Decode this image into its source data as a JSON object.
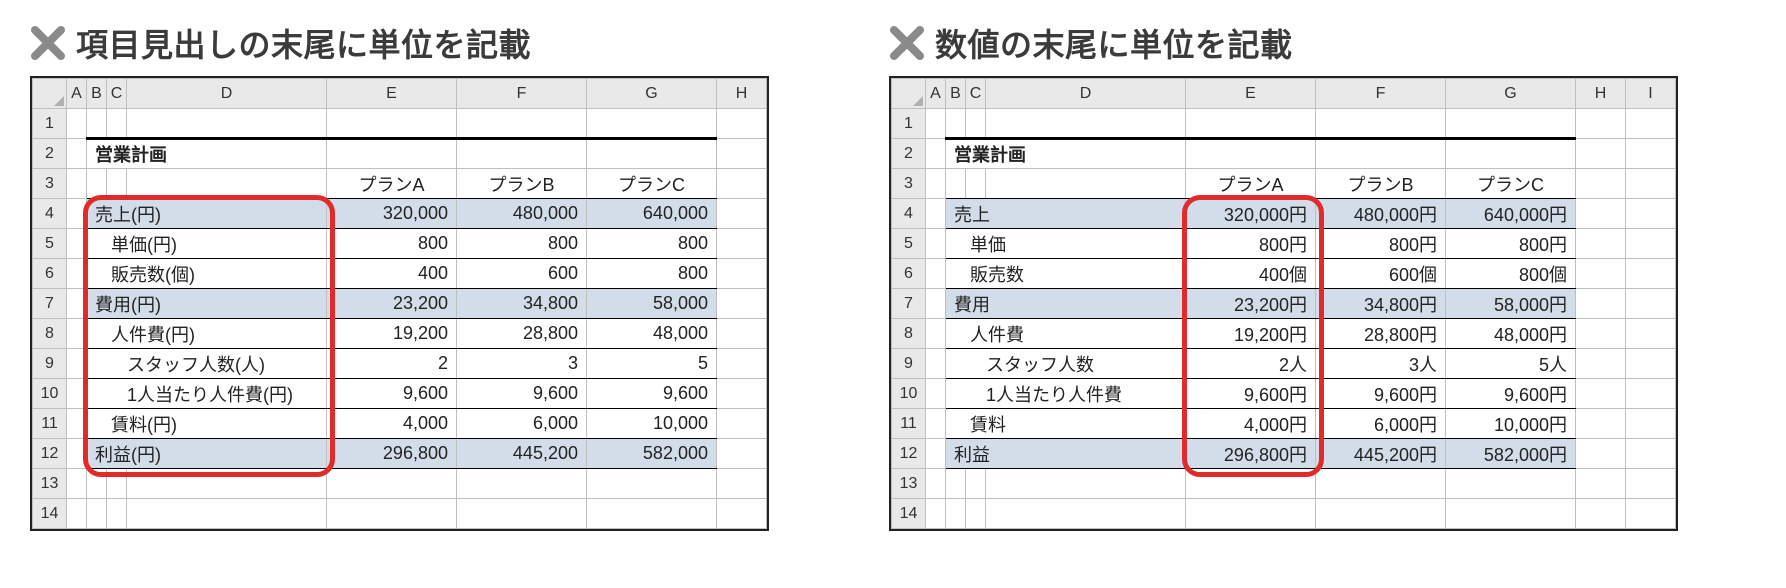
{
  "left": {
    "title": "項目見出しの末尾に単位を記載",
    "cols": [
      "A",
      "B",
      "C",
      "D",
      "E",
      "F",
      "G",
      "H"
    ],
    "tableTitle": "営業計画",
    "planHeaders": {
      "e": "プランA",
      "f": "プランB",
      "g": "プランC"
    },
    "rows": [
      {
        "label": "売上(円)",
        "e": "320,000",
        "f": "480,000",
        "g": "640,000",
        "shaded": true,
        "indent": 0,
        "uline": true
      },
      {
        "label": "単価(円)",
        "e": "800",
        "f": "800",
        "g": "800",
        "shaded": false,
        "indent": 1,
        "uline": true
      },
      {
        "label": "販売数(個)",
        "e": "400",
        "f": "600",
        "g": "800",
        "shaded": false,
        "indent": 1,
        "uline": true
      },
      {
        "label": "費用(円)",
        "e": "23,200",
        "f": "34,800",
        "g": "58,000",
        "shaded": true,
        "indent": 0,
        "uline": true
      },
      {
        "label": "人件費(円)",
        "e": "19,200",
        "f": "28,800",
        "g": "48,000",
        "shaded": false,
        "indent": 1,
        "uline": true
      },
      {
        "label": "スタッフ人数(人)",
        "e": "2",
        "f": "3",
        "g": "5",
        "shaded": false,
        "indent": 2,
        "uline": true
      },
      {
        "label": "1人当たり人件費(円)",
        "e": "9,600",
        "f": "9,600",
        "g": "9,600",
        "shaded": false,
        "indent": 2,
        "uline": true
      },
      {
        "label": "賃料(円)",
        "e": "4,000",
        "f": "6,000",
        "g": "10,000",
        "shaded": false,
        "indent": 1,
        "uline": true
      },
      {
        "label": "利益(円)",
        "e": "296,800",
        "f": "445,200",
        "g": "582,000",
        "shaded": true,
        "indent": 0,
        "uline": true
      }
    ],
    "highlightTarget": "labels"
  },
  "right": {
    "title": "数値の末尾に単位を記載",
    "cols": [
      "A",
      "B",
      "C",
      "D",
      "E",
      "F",
      "G",
      "H",
      "I"
    ],
    "tableTitle": "営業計画",
    "planHeaders": {
      "e": "プランA",
      "f": "プランB",
      "g": "プランC"
    },
    "rows": [
      {
        "label": "売上",
        "e": "320,000円",
        "f": "480,000円",
        "g": "640,000円",
        "shaded": true,
        "indent": 0,
        "uline": true
      },
      {
        "label": "単価",
        "e": "800円",
        "f": "800円",
        "g": "800円",
        "shaded": false,
        "indent": 1,
        "uline": true
      },
      {
        "label": "販売数",
        "e": "400個",
        "f": "600個",
        "g": "800個",
        "shaded": false,
        "indent": 1,
        "uline": true
      },
      {
        "label": "費用",
        "e": "23,200円",
        "f": "34,800円",
        "g": "58,000円",
        "shaded": true,
        "indent": 0,
        "uline": true
      },
      {
        "label": "人件費",
        "e": "19,200円",
        "f": "28,800円",
        "g": "48,000円",
        "shaded": false,
        "indent": 1,
        "uline": true
      },
      {
        "label": "スタッフ人数",
        "e": "2人",
        "f": "3人",
        "g": "5人",
        "shaded": false,
        "indent": 2,
        "uline": true
      },
      {
        "label": "1人当たり人件費",
        "e": "9,600円",
        "f": "9,600円",
        "g": "9,600円",
        "shaded": false,
        "indent": 2,
        "uline": true
      },
      {
        "label": "賃料",
        "e": "4,000円",
        "f": "6,000円",
        "g": "10,000円",
        "shaded": false,
        "indent": 1,
        "uline": true
      },
      {
        "label": "利益",
        "e": "296,800円",
        "f": "445,200円",
        "g": "582,000円",
        "shaded": true,
        "indent": 0,
        "uline": true
      }
    ],
    "highlightTarget": "colE"
  }
}
